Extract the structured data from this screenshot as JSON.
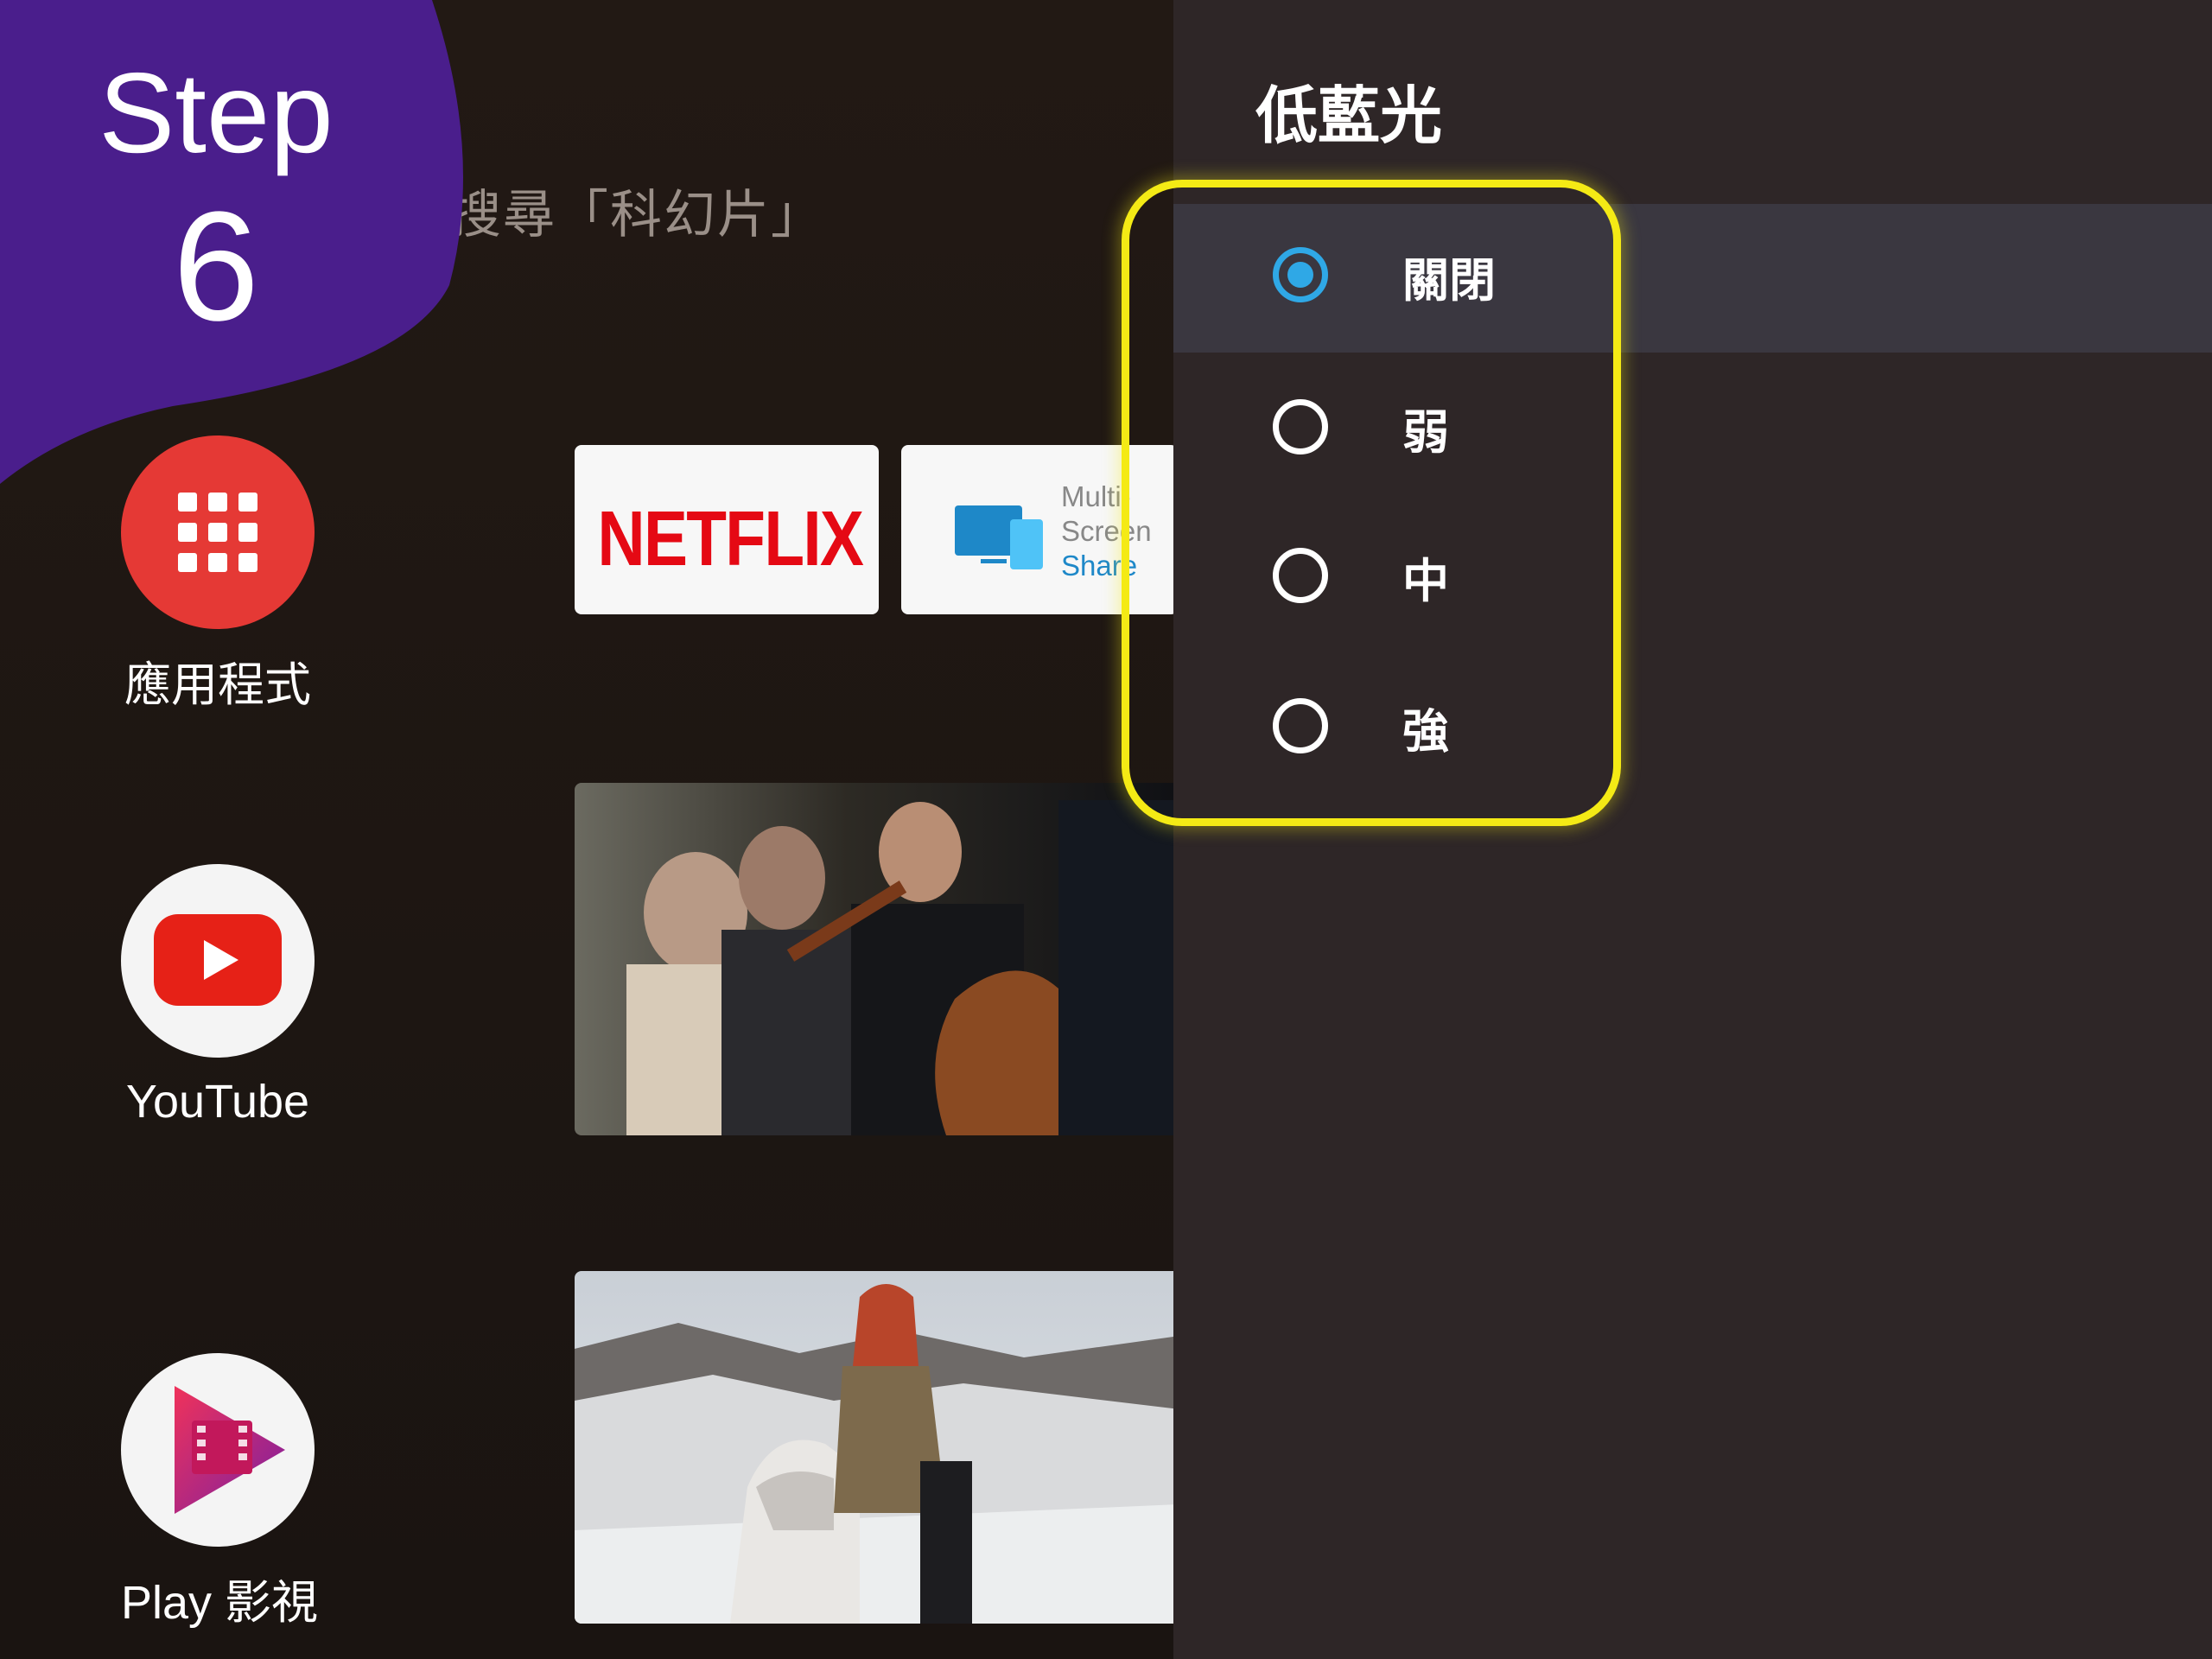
{
  "step": {
    "label": "Step",
    "number": "6"
  },
  "search_hint": "搜尋「科幻片」",
  "apps": [
    {
      "label": "應用程式",
      "icon": "grid-icon"
    },
    {
      "label": "YouTube",
      "icon": "youtube-icon"
    },
    {
      "label": "Play 影視",
      "icon": "play-movies-icon"
    }
  ],
  "tiles": {
    "netflix": "NETFLIX",
    "mss": {
      "line1": "Multi-",
      "line2": "Screen",
      "line3": "Share"
    }
  },
  "panel": {
    "title": "低藍光",
    "options": [
      {
        "label": "關閉",
        "selected": true
      },
      {
        "label": "弱",
        "selected": false
      },
      {
        "label": "中",
        "selected": false
      },
      {
        "label": "強",
        "selected": false
      }
    ]
  },
  "colors": {
    "step_badge": "#4a1e8c",
    "highlight": "#f4ea15",
    "radio_selected": "#2fa8e6",
    "panel_bg": "#2e2627"
  }
}
